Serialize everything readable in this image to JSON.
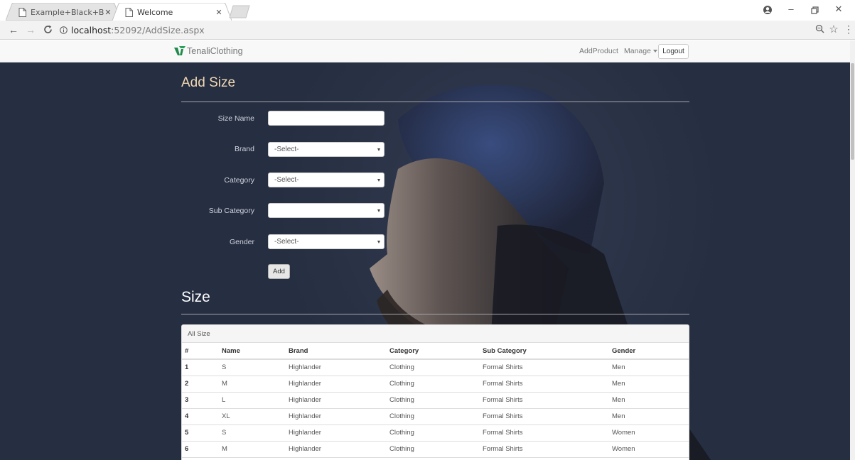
{
  "browser": {
    "tabs": [
      {
        "title": "Example+Black+Book+c",
        "active": false
      },
      {
        "title": "Welcome",
        "active": true
      }
    ],
    "url_host": "localhost",
    "url_path": ":52092/AddSize.aspx"
  },
  "navbar": {
    "brand": "TenaliClothing",
    "links": {
      "add_product": "AddProduct",
      "manage": "Manage",
      "logout": "Logout"
    }
  },
  "form": {
    "title": "Add Size",
    "size_name": {
      "label": "Size Name",
      "value": ""
    },
    "brand": {
      "label": "Brand",
      "selected": "-Select-"
    },
    "category": {
      "label": "Category",
      "selected": "-Select-"
    },
    "sub_category": {
      "label": "Sub Category",
      "selected": ""
    },
    "gender": {
      "label": "Gender",
      "selected": "-Select-"
    },
    "add_button": "Add"
  },
  "size_section": {
    "title": "Size",
    "panel_heading": "All Size",
    "columns": [
      "#",
      "Name",
      "Brand",
      "Category",
      "Sub Category",
      "Gender"
    ],
    "rows": [
      [
        "1",
        "S",
        "Highlander",
        "Clothing",
        "Formal Shirts",
        "Men"
      ],
      [
        "2",
        "M",
        "Highlander",
        "Clothing",
        "Formal Shirts",
        "Men"
      ],
      [
        "3",
        "L",
        "Highlander",
        "Clothing",
        "Formal Shirts",
        "Men"
      ],
      [
        "4",
        "XL",
        "Highlander",
        "Clothing",
        "Formal Shirts",
        "Men"
      ],
      [
        "5",
        "S",
        "Highlander",
        "Clothing",
        "Formal Shirts",
        "Women"
      ],
      [
        "6",
        "M",
        "Highlander",
        "Clothing",
        "Formal Shirts",
        "Women"
      ]
    ]
  }
}
